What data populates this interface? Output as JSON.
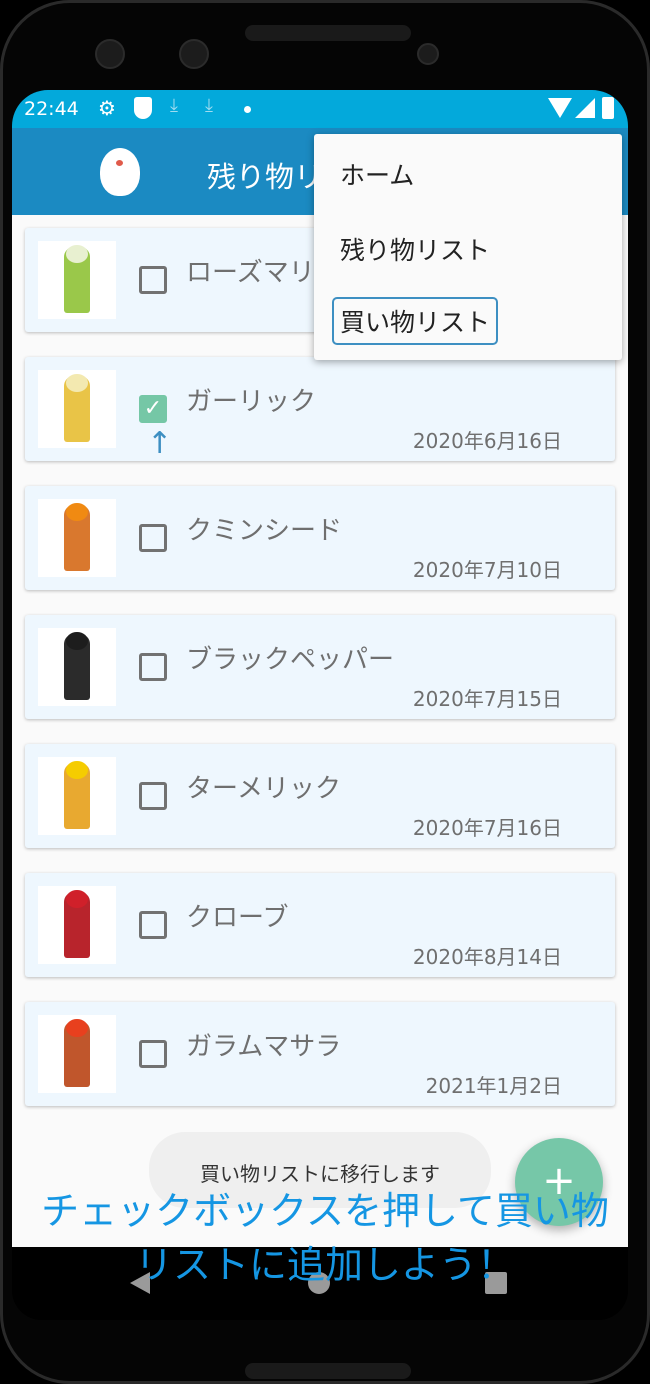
{
  "status_bar": {
    "time": "22:44",
    "icons": [
      "gear-icon",
      "shield-play-icon",
      "download-icon",
      "download-icon",
      "dot-icon",
      "wifi-icon",
      "signal-icon",
      "battery-icon"
    ]
  },
  "app_bar": {
    "title": "残り物リスト",
    "logo": "bird-logo"
  },
  "menu": {
    "items": [
      {
        "label": "ホーム",
        "selected": false
      },
      {
        "label": "残り物リスト",
        "selected": false
      },
      {
        "label": "買い物リスト",
        "selected": true
      }
    ]
  },
  "items": [
    {
      "name": "ローズマリー",
      "date": "",
      "checked": false,
      "jar_color": "#9ac84a",
      "cap_color": "#e8f0d0"
    },
    {
      "name": "ガーリック",
      "date": "2020年6月16日",
      "checked": true,
      "jar_color": "#e9c447",
      "cap_color": "#f3e9b0"
    },
    {
      "name": "クミンシード",
      "date": "2020年7月10日",
      "checked": false,
      "jar_color": "#d9782e",
      "cap_color": "#f08a12"
    },
    {
      "name": "ブラックペッパー",
      "date": "2020年7月15日",
      "checked": false,
      "jar_color": "#2b2b2b",
      "cap_color": "#1d1d1d"
    },
    {
      "name": "ターメリック",
      "date": "2020年7月16日",
      "checked": false,
      "jar_color": "#e8a930",
      "cap_color": "#f5cc00"
    },
    {
      "name": "クローブ",
      "date": "2020年8月14日",
      "checked": false,
      "jar_color": "#b8242c",
      "cap_color": "#d0202a"
    },
    {
      "name": "ガラムマサラ",
      "date": "2021年1月2日",
      "checked": false,
      "jar_color": "#c0562c",
      "cap_color": "#e8401e"
    }
  ],
  "toast": "買い物リストに移行します",
  "fab_label": "+",
  "annotation": "チェックボックスを押して買い物\nリストに追加しよう！",
  "colors": {
    "status_bar": "#03a9db",
    "app_bar": "#1b8ac2",
    "accent": "#75c7a6",
    "annotation": "#1596e3"
  }
}
